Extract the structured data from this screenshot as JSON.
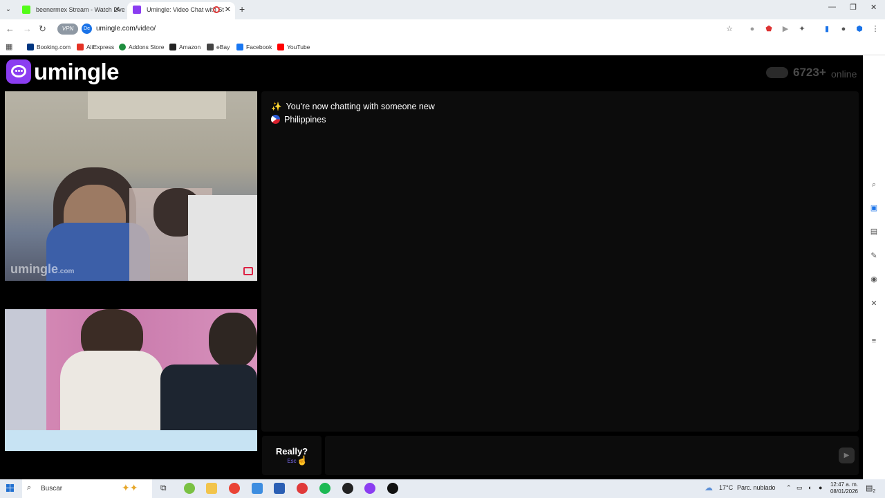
{
  "browser": {
    "tabs": [
      {
        "title": "beenermex Stream - Watch Live",
        "active": false,
        "favicon_color": "#53fc18"
      },
      {
        "title": "Umingle: Video Chat with St",
        "active": true,
        "favicon_color": "#8b3df1"
      }
    ],
    "vpn_label": "VPN",
    "url": "umingle.com/video/",
    "bookmarks": [
      {
        "label": "Booking.com",
        "color": "#003580"
      },
      {
        "label": "AliExpress",
        "color": "#e43225"
      },
      {
        "label": "Addons Store",
        "color": "#1e8e3e"
      },
      {
        "label": "Amazon",
        "color": "#222222"
      },
      {
        "label": "eBay",
        "color": "#444444"
      },
      {
        "label": "Facebook",
        "color": "#1877f2"
      },
      {
        "label": "YouTube",
        "color": "#ff0000"
      }
    ]
  },
  "page": {
    "logo_text": "umingle",
    "online_count": "6723+",
    "online_label": "online",
    "remote_video_watermark": "umingle",
    "remote_video_watermark_suffix": ".com",
    "chat": {
      "status_message": "You're now chatting with someone new",
      "partner_country": "Philippines"
    },
    "next_button": {
      "label": "Really?",
      "hint": "Esc"
    },
    "message_input": {
      "placeholder": "",
      "value": ""
    },
    "send_icon": "send-icon"
  },
  "sidebar_icons": [
    "search-icon",
    "chat-icon",
    "office-icon",
    "notes-icon",
    "games-icon",
    "tools-icon",
    "settings-icon"
  ],
  "taskbar": {
    "search_placeholder": "Buscar",
    "weather_temp": "17°C",
    "weather_desc": "Parc. nublado",
    "time": "12:47 a. m.",
    "date": "08/01/2026",
    "notification_count": "2"
  }
}
